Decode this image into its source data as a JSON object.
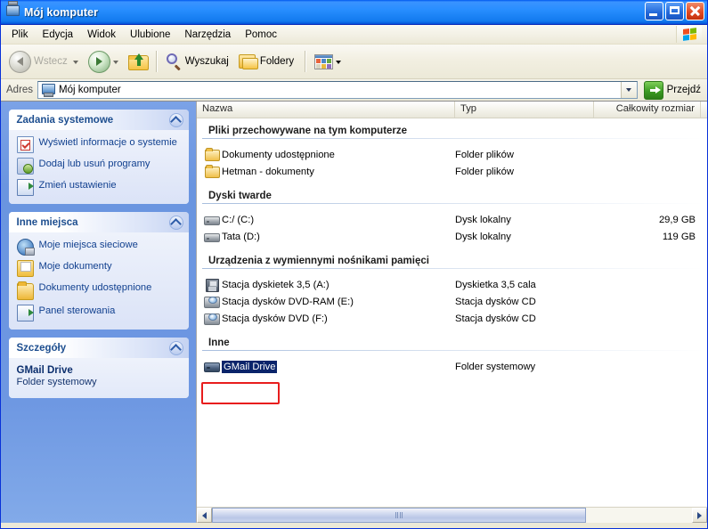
{
  "window": {
    "title": "Mój komputer",
    "icon": "my-computer-icon",
    "controls": {
      "minimize": "Minimalizuj",
      "maximize": "Maksymalizuj",
      "close": "Zamknij"
    }
  },
  "menu": {
    "items": [
      "Plik",
      "Edycja",
      "Widok",
      "Ulubione",
      "Narzędzia",
      "Pomoc"
    ],
    "logo": "windows-flag-logo"
  },
  "toolbar": {
    "back": "Wstecz",
    "forward": "",
    "up": "",
    "search": "Wyszukaj",
    "folders": "Foldery",
    "views": ""
  },
  "address": {
    "label": "Adres",
    "value": "Mój komputer",
    "go": "Przejdź"
  },
  "sidebar": {
    "panels": [
      {
        "title": "Zadania systemowe",
        "items": [
          {
            "label": "Wyświetl informacje o systemie",
            "icon": "system-info-icon"
          },
          {
            "label": "Dodaj lub usuń programy",
            "icon": "add-remove-programs-icon"
          },
          {
            "label": "Zmień ustawienie",
            "icon": "change-settings-icon"
          }
        ]
      },
      {
        "title": "Inne miejsca",
        "items": [
          {
            "label": "Moje miejsca sieciowe",
            "icon": "network-places-icon"
          },
          {
            "label": "Moje dokumenty",
            "icon": "my-documents-icon"
          },
          {
            "label": "Dokumenty udostępnione",
            "icon": "shared-documents-icon"
          },
          {
            "label": "Panel sterowania",
            "icon": "control-panel-icon"
          }
        ]
      }
    ],
    "details": {
      "title": "Szczegóły",
      "name": "GMail Drive",
      "type": "Folder systemowy"
    }
  },
  "list": {
    "columns": [
      "Nazwa",
      "Typ",
      "Całkowity rozmiar"
    ],
    "groups": [
      {
        "title": "Pliki przechowywane na tym komputerze",
        "rows": [
          {
            "name": "Dokumenty udostępnione",
            "type": "Folder plików",
            "size": "",
            "icon": "folder-icon",
            "selected": false
          },
          {
            "name": "Hetman - dokumenty",
            "type": "Folder plików",
            "size": "",
            "icon": "folder-icon",
            "selected": false
          }
        ]
      },
      {
        "title": "Dyski twarde",
        "rows": [
          {
            "name": "C:/ (C:)",
            "type": "Dysk lokalny",
            "size": "29,9 GB",
            "icon": "hard-drive-icon",
            "selected": false
          },
          {
            "name": "Tata (D:)",
            "type": "Dysk lokalny",
            "size": "119 GB",
            "icon": "hard-drive-icon",
            "selected": false
          }
        ]
      },
      {
        "title": "Urządzenia z wymiennymi nośnikami pamięci",
        "rows": [
          {
            "name": "Stacja dyskietek 3,5 (A:)",
            "type": "Dyskietka 3,5 cala",
            "size": "",
            "icon": "floppy-drive-icon",
            "selected": false
          },
          {
            "name": "Stacja dysków DVD-RAM (E:)",
            "type": "Stacja dysków CD",
            "size": "",
            "icon": "cd-drive-icon",
            "selected": false
          },
          {
            "name": "Stacja dysków DVD (F:)",
            "type": "Stacja dysków CD",
            "size": "",
            "icon": "cd-drive-icon",
            "selected": false
          }
        ]
      },
      {
        "title": "Inne",
        "rows": [
          {
            "name": "GMail Drive",
            "type": "Folder systemowy",
            "size": "",
            "icon": "gmail-drive-icon",
            "selected": true
          }
        ]
      }
    ]
  },
  "annotation": {
    "color": "#e81d1d",
    "target": "GMail Drive"
  },
  "colors": {
    "title_bar": "#0058ee",
    "sidebar": "#6f9ae3",
    "selection": "#0a246a",
    "annotation": "#e81d1d"
  }
}
